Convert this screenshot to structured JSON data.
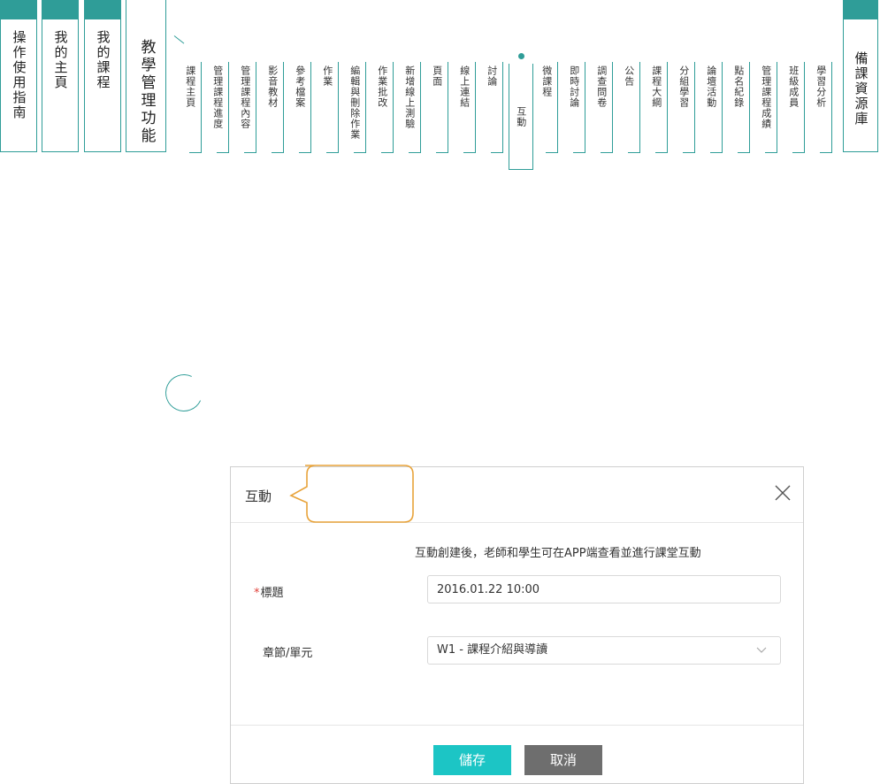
{
  "nav": {
    "main_tabs": [
      {
        "label": "操作使用指南"
      },
      {
        "label": "我的主頁"
      },
      {
        "label": "我的課程"
      }
    ],
    "feature_tab": {
      "label": "教學管理功能"
    },
    "sub_items": [
      {
        "label": "課程主頁"
      },
      {
        "label": "管理課程進度"
      },
      {
        "label": "管理課程內容"
      },
      {
        "label": "影音教材"
      },
      {
        "label": "參考檔案"
      },
      {
        "label": "作業"
      },
      {
        "label": "編輯與刪除作業"
      },
      {
        "label": "作業批改"
      },
      {
        "label": "新增線上測驗"
      },
      {
        "label": "頁面"
      },
      {
        "label": "線上連結"
      },
      {
        "label": "討論"
      },
      {
        "label": "互動",
        "active": true
      },
      {
        "label": "微課程"
      },
      {
        "label": "即時討論"
      },
      {
        "label": "調查問卷"
      },
      {
        "label": "公告"
      },
      {
        "label": "課程大綱"
      },
      {
        "label": "分組學習"
      },
      {
        "label": "論壇活動"
      },
      {
        "label": "點名紀錄"
      },
      {
        "label": "管理課程成績"
      },
      {
        "label": "班級成員"
      },
      {
        "label": "學習分析"
      }
    ],
    "resource_tab": {
      "label": "備課資源庫"
    }
  },
  "dialog": {
    "title": "互動",
    "intro": "互動創建後，老師和學生可在APP端查看並進行課堂互動",
    "required_mark": "*",
    "title_label": "標題",
    "title_value": "2016.01.22 10:00",
    "section_label": "章節/單元",
    "section_value": "W1 - 課程介紹與導讀",
    "save_label": "儲存",
    "cancel_label": "取消"
  },
  "colors": {
    "accent": "#2f9d98",
    "save_button": "#1cc5c5",
    "cancel_button": "#6e6e6e",
    "callout": "#e8a33a",
    "required": "#e0413a"
  }
}
